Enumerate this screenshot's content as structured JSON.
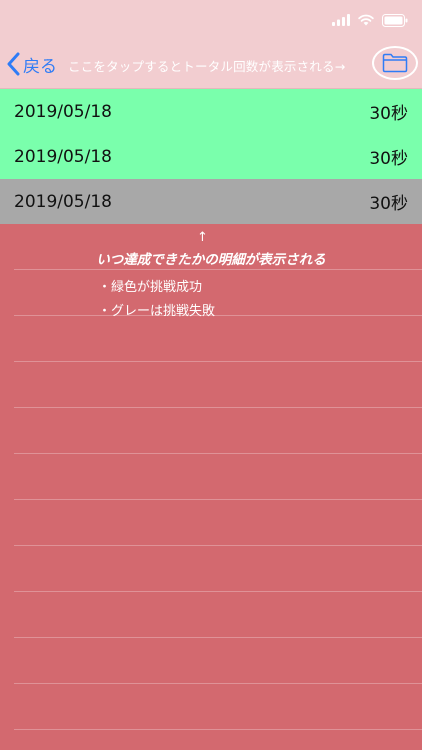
{
  "statusbar": {
    "icons": [
      "signal-icon",
      "wifi-icon",
      "battery-icon"
    ]
  },
  "nav": {
    "back_label": "戻る",
    "title": "ここをタップするとトータル回数が表示される→",
    "folder_icon": "folder-icon"
  },
  "records": [
    {
      "date": "2019/05/18",
      "duration": "30秒",
      "status": "success"
    },
    {
      "date": "2019/05/18",
      "duration": "30秒",
      "status": "success"
    },
    {
      "date": "2019/05/18",
      "duration": "30秒",
      "status": "fail"
    }
  ],
  "note": {
    "arrow": "↑",
    "title": "いつ達成できたかの明細が表示される",
    "items": [
      "・緑色が挑戦成功",
      "・グレーは挑戦失敗"
    ]
  },
  "colors": {
    "background": "#d3696f",
    "header": "#f2cdd0",
    "success": "#7affac",
    "fail": "#a8a8a8",
    "accent": "#2f7cf6"
  }
}
